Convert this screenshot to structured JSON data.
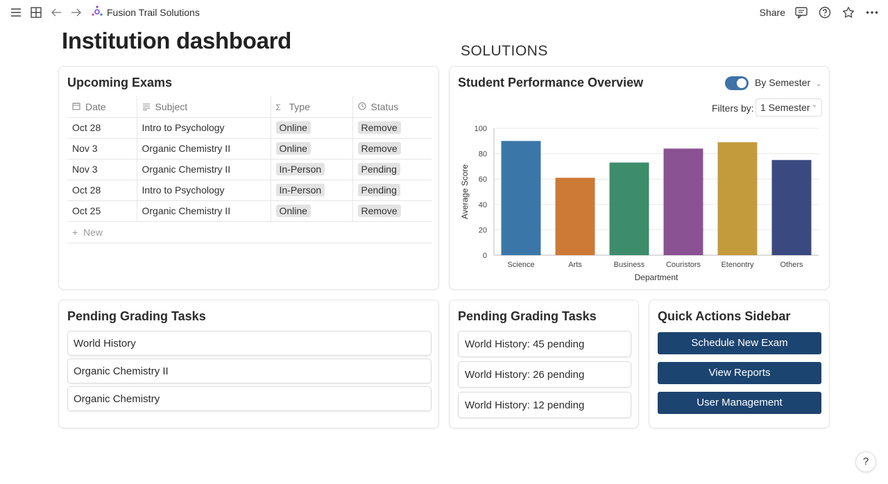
{
  "topbar": {
    "workspace": "Fusion Trail Solutions",
    "share_label": "Share",
    "icons": [
      "menu-icon",
      "layout-icon",
      "back-arrow-icon",
      "forward-arrow-icon",
      "workspace-logo-icon",
      "comment-icon",
      "help-icon",
      "star-icon",
      "more-icon"
    ]
  },
  "page": {
    "title": "Institution dashboard",
    "ghost_text": "SOLUTIONS"
  },
  "exams": {
    "title": "Upcoming Exams",
    "columns": [
      "Date",
      "Subject",
      "Type",
      "Status"
    ],
    "rows": [
      [
        "Oct 28",
        "Intro to Psychology",
        "Online",
        "Remove"
      ],
      [
        "Nov 3",
        "Organic Chemistry II",
        "Online",
        "Remove"
      ],
      [
        "Nov 3",
        "Organic Chemistry II",
        "In-Person",
        "Pending"
      ],
      [
        "Oct 28",
        "Intro to Psychology",
        "In-Person",
        "Pending"
      ],
      [
        "Oct 25",
        "Organic Chemistry II",
        "Online",
        "Remove"
      ]
    ],
    "new_label": "New"
  },
  "performance": {
    "title": "Student Performance Overview",
    "toggle_label": "By Semester",
    "filters_label": "Filters by:",
    "filter_value": "1 Semester"
  },
  "chart_data": {
    "type": "bar",
    "categories": [
      "Science",
      "Arts",
      "Business",
      "Couristors",
      "Etenontry",
      "Others"
    ],
    "values": [
      90,
      61,
      73,
      84,
      89,
      75
    ],
    "colors": [
      "#3a77a8",
      "#cc7a35",
      "#3d8c6c",
      "#8a5293",
      "#c49b3c",
      "#3a4a80"
    ],
    "xlabel": "Department",
    "ylabel": "Average Score",
    "ylim": [
      0,
      100
    ],
    "yticks": [
      0,
      20,
      40,
      60,
      80,
      100
    ],
    "grid": true
  },
  "grading_main": {
    "title": "Pending Grading Tasks",
    "items": [
      "World History",
      "Organic Chemistry II",
      "Organic Chemistry"
    ]
  },
  "grading_side": {
    "title": "Pending Grading Tasks",
    "items": [
      "World History: 45 pending",
      "World History: 26 pending",
      "World History: 12 pending"
    ]
  },
  "quick_actions": {
    "title": "Quick Actions Sidebar",
    "buttons": [
      "Schedule New Exam",
      "View Reports",
      "User Management"
    ],
    "button_color": "#1c4470"
  },
  "help_label": "?"
}
